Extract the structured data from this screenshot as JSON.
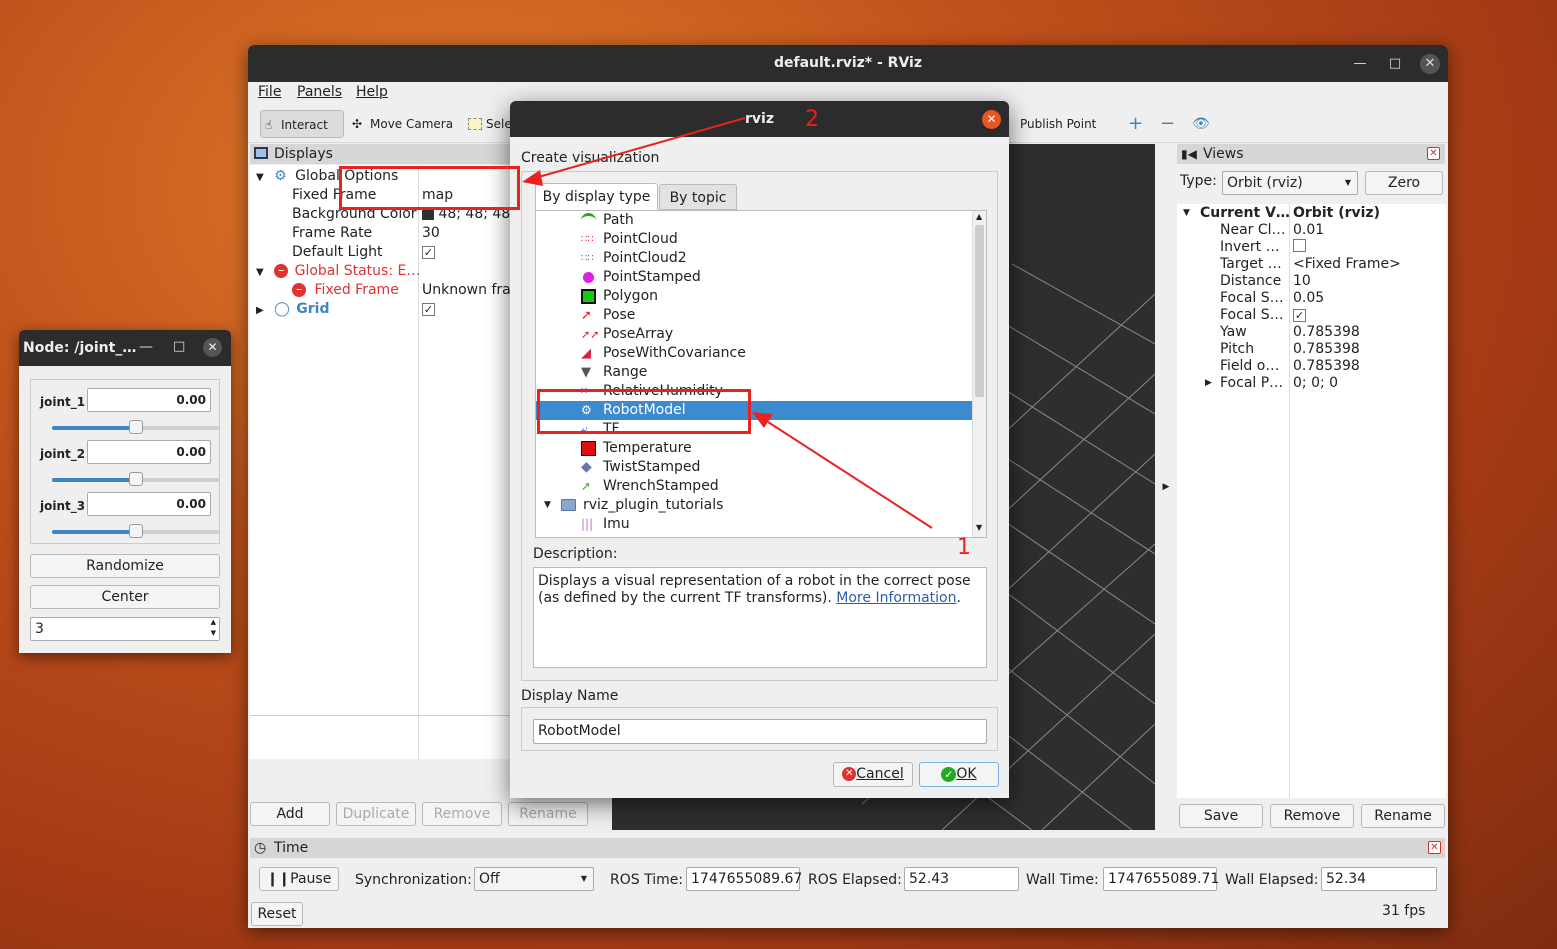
{
  "window": {
    "title": "default.rviz* - RViz"
  },
  "menu": {
    "file": "File",
    "panels": "Panels",
    "help": "Help"
  },
  "toolbar": {
    "interact": "Interact",
    "move_camera": "Move Camera",
    "select": "Sele",
    "publish_point": "Publish Point"
  },
  "displays": {
    "title": "Displays",
    "global_options": "Global Options",
    "fixed_frame_label": "Fixed Frame",
    "fixed_frame_value": "map",
    "bg_color_label": "Background Color",
    "bg_color_value": "48; 48; 48",
    "frame_rate_label": "Frame Rate",
    "frame_rate_value": "30",
    "default_light_label": "Default Light",
    "global_status": "Global Status: E…",
    "fixed_frame_err": "Fixed Frame",
    "fixed_frame_err_value": "Unknown fra",
    "grid": "Grid",
    "buttons": {
      "add": "Add",
      "duplicate": "Duplicate",
      "remove": "Remove",
      "rename": "Rename"
    }
  },
  "views": {
    "title": "Views",
    "type_label": "Type:",
    "type_value": "Orbit (rviz)",
    "zero": "Zero",
    "rows": [
      {
        "label": "Current V…",
        "value": "Orbit (rviz)"
      },
      {
        "label": "Near Cl…",
        "value": "0.01"
      },
      {
        "label": "Invert …",
        "value": ""
      },
      {
        "label": "Target …",
        "value": "<Fixed Frame>"
      },
      {
        "label": "Distance",
        "value": "10"
      },
      {
        "label": "Focal S…",
        "value": "0.05"
      },
      {
        "label": "Focal S…",
        "value": ""
      },
      {
        "label": "Yaw",
        "value": "0.785398"
      },
      {
        "label": "Pitch",
        "value": "0.785398"
      },
      {
        "label": "Field o…",
        "value": "0.785398"
      },
      {
        "label": "Focal P…",
        "value": "0; 0; 0"
      }
    ],
    "buttons": {
      "save": "Save",
      "remove": "Remove",
      "rename": "Rename"
    }
  },
  "time": {
    "title": "Time",
    "pause": "Pause",
    "sync_label": "Synchronization:",
    "sync_value": "Off",
    "ros_time_label": "ROS Time:",
    "ros_time": "1747655089.67",
    "ros_elapsed_label": "ROS Elapsed:",
    "ros_elapsed": "52.43",
    "wall_time_label": "Wall Time:",
    "wall_time": "1747655089.71",
    "wall_elapsed_label": "Wall Elapsed:",
    "wall_elapsed": "52.34",
    "reset": "Reset",
    "fps": "31 fps"
  },
  "node": {
    "title": "Node: /joint_…",
    "joints": [
      {
        "name": "joint_1",
        "value": "0.00",
        "level": 0.5
      },
      {
        "name": "joint_2",
        "value": "0.00",
        "level": 0.5
      },
      {
        "name": "joint_3",
        "value": "0.00",
        "level": 0.5
      }
    ],
    "randomize": "Randomize",
    "center": "Center",
    "spin_value": "3"
  },
  "dialog": {
    "title": "rviz",
    "heading": "Create visualization",
    "tab_type": "By display type",
    "tab_topic": "By topic",
    "items": [
      "Path",
      "PointCloud",
      "PointCloud2",
      "PointStamped",
      "Polygon",
      "Pose",
      "PoseArray",
      "PoseWithCovariance",
      "Range",
      "RelativeHumidity",
      "RobotModel",
      "TF",
      "Temperature",
      "TwistStamped",
      "WrenchStamped"
    ],
    "folder": "rviz_plugin_tutorials",
    "subitem": "Imu",
    "description_label": "Description:",
    "description_text": "Displays a visual representation of a robot in the correct pose (as defined by the current TF transforms).",
    "more_info": "More Information",
    "display_name_label": "Display Name",
    "display_name_value": "RobotModel",
    "cancel": "Cancel",
    "ok": "OK"
  },
  "annotations": {
    "one": "1",
    "two": "2"
  },
  "colors": {
    "accent": "#3d86c6",
    "selection": "#3c8bd0",
    "annotation": "#e8231f"
  }
}
